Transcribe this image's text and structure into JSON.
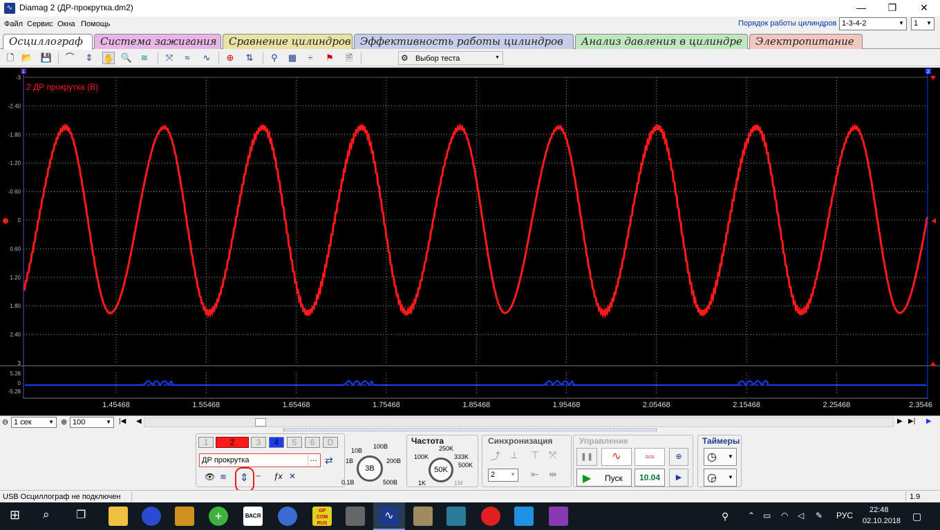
{
  "window": {
    "title": "Diamag 2 (ДР-прокрутка.dm2)",
    "controls": {
      "minimize": "—",
      "maximize": "❐",
      "close": "✕"
    }
  },
  "menu": [
    "Файл",
    "Сервис",
    "Окна",
    "Помощь"
  ],
  "cylinder_order": {
    "label": "Порядок работы цилиндров",
    "value": "1-3-4-2",
    "count": "1"
  },
  "tabs": [
    {
      "label": "Осциллограф",
      "color": "#ffffff"
    },
    {
      "label": "Система зажигания",
      "color": "#e8b6e6"
    },
    {
      "label": "Сравнение цилиндров",
      "color": "#e8e2a4"
    },
    {
      "label": "Эффективность работы цилиндров",
      "color": "#c7cde9"
    },
    {
      "label": "Анализ давления в цилиндре",
      "color": "#bfe6bf"
    },
    {
      "label": "Электропитание",
      "color": "#f0c8c0"
    }
  ],
  "toolbar": {
    "test_select": "Выбор теста"
  },
  "scope": {
    "channel_label": "2 ДР прокрутка (В)",
    "y_ticks": [
      "-3",
      "-2.40",
      "-1.80",
      "-1.20",
      "-0.60",
      "0",
      "0.60",
      "1.20",
      "1.80",
      "2.40",
      "3"
    ],
    "x_ticks": [
      "1.45468",
      "1.55468",
      "1.65468",
      "1.75468",
      "1.85468",
      "1.95468",
      "2.05468",
      "2.15468",
      "2.25468",
      "2.3546"
    ],
    "sub_ticks": [
      "5.28",
      "0",
      "-5.28"
    ],
    "markers": {
      "left": "1",
      "right": "2"
    },
    "colors": {
      "trace": "#ff1a1a",
      "sub_trace": "#1a3cff",
      "grid": "#9a9a9a"
    }
  },
  "timebase": {
    "value": "1 сек",
    "points": "100"
  },
  "channels": [
    "1",
    "2",
    "3",
    "4",
    "5",
    "6",
    "D"
  ],
  "channel_name": "ДР прокрутка",
  "voltage_knob": {
    "value": "3В",
    "labels": [
      "10В",
      "100В",
      "1В",
      "200В",
      "0,1В",
      "500В"
    ]
  },
  "frequency": {
    "title": "Частота",
    "value": "50K",
    "labels": [
      "250K",
      "100K",
      "333K",
      "500K",
      "1K",
      "1M"
    ]
  },
  "sync": {
    "title": "Синхронизация",
    "value": "2"
  },
  "control": {
    "title": "Управление",
    "start": "Пуск",
    "value": "10.04"
  },
  "timers": {
    "title": "Таймеры"
  },
  "status": {
    "text": "USB Осциллограф не подключен",
    "version": "1.9"
  },
  "taskbar": {
    "language": "РУС",
    "time": "22:48",
    "date": "02.10.2018",
    "vasya_label": "ВАСЯ",
    "gp_label": "GP COM RUS"
  }
}
